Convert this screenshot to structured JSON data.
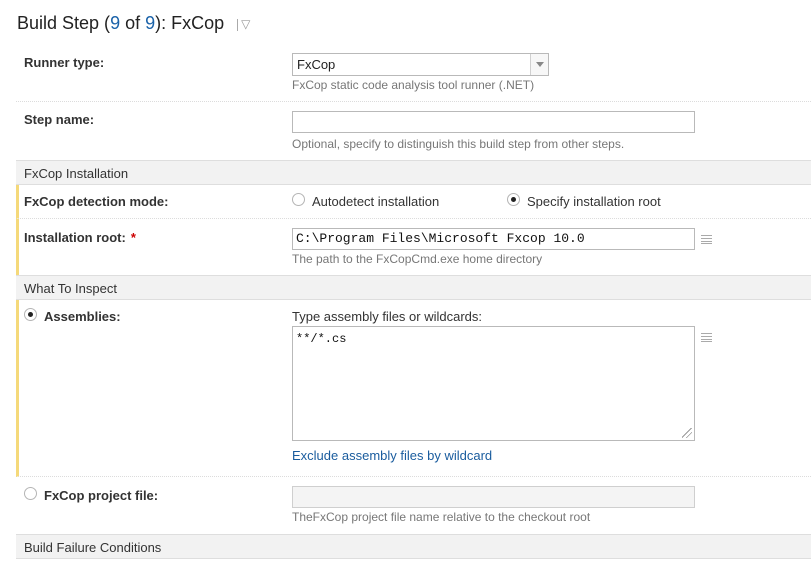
{
  "header": {
    "prefix": "Build Step (",
    "current": "9",
    "of": " of ",
    "total": "9",
    "suffix": "): FxCop"
  },
  "runner": {
    "label": "Runner type:",
    "value": "FxCop",
    "hint": "FxCop static code analysis tool runner (.NET)"
  },
  "step_name": {
    "label": "Step name:",
    "value": "",
    "hint": "Optional, specify to distinguish this build step from other steps."
  },
  "sections": {
    "installation": "FxCop Installation",
    "inspect": "What To Inspect",
    "failure": "Build Failure Conditions"
  },
  "detection": {
    "label": "FxCop detection mode:",
    "option_auto": "Autodetect installation",
    "option_root": "Specify installation root",
    "selected": "Specify installation root"
  },
  "install_root": {
    "label": "Installation root:",
    "required_mark": "*",
    "value": "C:\\Program Files\\Microsoft Fxcop 10.0",
    "hint": "The path to the FxCopCmd.exe home directory"
  },
  "assemblies": {
    "label": "Assemblies:",
    "prompt": "Type assembly files or wildcards:",
    "value": "**/*.cs",
    "exclude_link": "Exclude assembly files by wildcard"
  },
  "project_file": {
    "label": "FxCop project file:",
    "value": "",
    "hint": "TheFxCop project file name relative to the checkout root"
  },
  "icons": {
    "header_menu": "chevron-down-icon",
    "list_editor": "list-icon"
  },
  "colors": {
    "link": "#1a5c9e",
    "highlight_bar": "#f5d97a",
    "required": "#cc0000"
  }
}
